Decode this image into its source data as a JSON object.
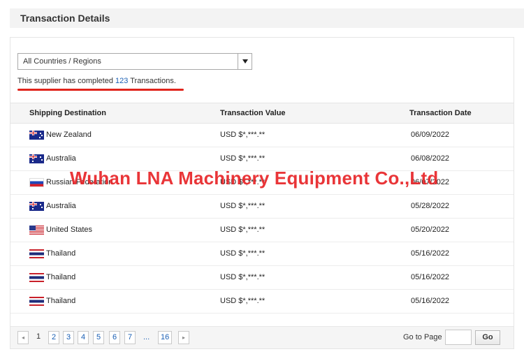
{
  "section": {
    "title": "Transaction Details"
  },
  "filter": {
    "selected": "All Countries / Regions"
  },
  "summary": {
    "prefix": "This supplier has completed",
    "count": "123",
    "suffix": "Transactions."
  },
  "table": {
    "headers": {
      "destination": "Shipping Destination",
      "value": "Transaction Value",
      "date": "Transaction Date"
    },
    "rows": [
      {
        "country": "New Zealand",
        "flag": "nz-flag",
        "value": "USD $*,***.**",
        "date": "06/09/2022"
      },
      {
        "country": "Australia",
        "flag": "au-flag",
        "value": "USD $*,***.**",
        "date": "06/08/2022"
      },
      {
        "country": "Russian Federation",
        "flag": "ru-flag",
        "value": "USD $*,***.**",
        "date": "06/07/2022"
      },
      {
        "country": "Australia",
        "flag": "au-flag",
        "value": "USD $*,***.**",
        "date": "05/28/2022"
      },
      {
        "country": "United States",
        "flag": "us-flag",
        "value": "USD $*,***.**",
        "date": "05/20/2022"
      },
      {
        "country": "Thailand",
        "flag": "th-flag",
        "value": "USD $*,***.**",
        "date": "05/16/2022"
      },
      {
        "country": "Thailand",
        "flag": "th-flag",
        "value": "USD $*,***.**",
        "date": "05/16/2022"
      },
      {
        "country": "Thailand",
        "flag": "th-flag",
        "value": "USD $*,***.**",
        "date": "05/16/2022"
      }
    ]
  },
  "watermark": {
    "text": "Wuhan LNA Machinery Equipment Co.,Ltd"
  },
  "pagination": {
    "prev": "◂",
    "next": "▸",
    "current": "1",
    "pages": [
      "2",
      "3",
      "4",
      "5",
      "6",
      "7"
    ],
    "ellipsis": "...",
    "last": "16",
    "goto_label": "Go to Page",
    "goto_value": "",
    "go_label": "Go"
  },
  "colors": {
    "accent_link": "#1a5fb4",
    "underline": "#e0241c",
    "watermark": "#e8262a"
  }
}
